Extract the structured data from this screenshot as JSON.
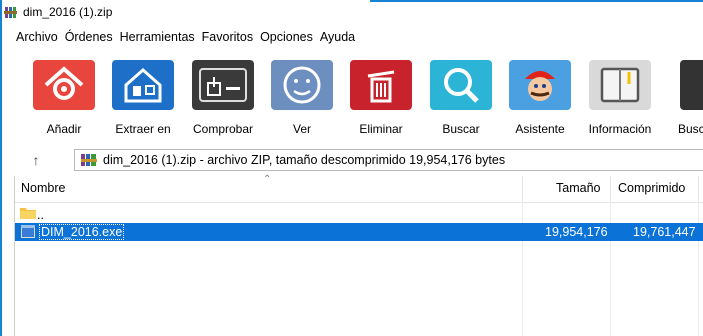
{
  "window": {
    "title": "dim_2016 (1).zip",
    "app_icon": "winrar-books-icon"
  },
  "menu": {
    "items": [
      "Archivo",
      "Órdenes",
      "Herramientas",
      "Favoritos",
      "Opciones",
      "Ayuda"
    ]
  },
  "toolbar": {
    "buttons": [
      {
        "label": "Añadir",
        "icon": "add-archive-icon",
        "color": "#e8453c"
      },
      {
        "label": "Extraer en",
        "icon": "extract-house-icon",
        "color": "#1e6fc8"
      },
      {
        "label": "Comprobar",
        "icon": "test-archive-icon",
        "color": "#3a3a3a"
      },
      {
        "label": "Ver",
        "icon": "view-face-icon",
        "color": "#6d8fbf"
      },
      {
        "label": "Eliminar",
        "icon": "delete-trash-icon",
        "color": "#c8232c"
      },
      {
        "label": "Buscar",
        "icon": "find-magnifier-icon",
        "color": "#2bb4d6"
      },
      {
        "label": "Asistente",
        "icon": "wizard-mario-icon",
        "color": "#4aa0e0"
      },
      {
        "label": "Información",
        "icon": "info-notebook-icon",
        "color": "#d9d9d9"
      },
      {
        "label": "Busc",
        "icon": "search-partial-icon",
        "color": "#333333"
      }
    ]
  },
  "address": {
    "text": "dim_2016 (1).zip - archivo ZIP, tamaño descomprimido 19,954,176 bytes"
  },
  "columns": {
    "name": "Nombre",
    "size": "Tamaño",
    "packed": "Comprimido"
  },
  "files": [
    {
      "name": "..",
      "icon": "folder-icon",
      "size": "",
      "packed": "",
      "selected": false
    },
    {
      "name": "DIM_2016.exe",
      "icon": "exe-file-icon",
      "size": "19,954,176",
      "packed": "19,761,447",
      "selected": true
    }
  ]
}
